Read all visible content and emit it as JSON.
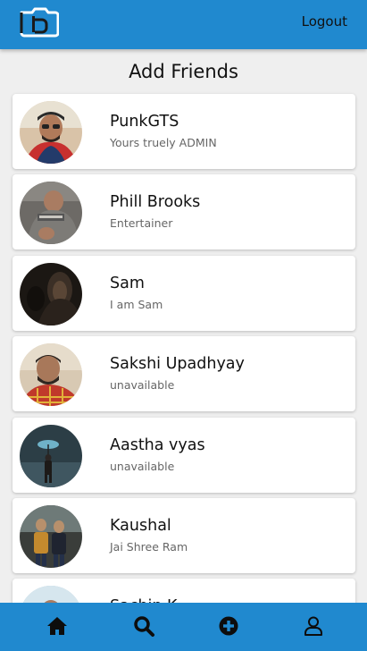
{
  "header": {
    "logout_label": "Logout",
    "brand_color": "#2089cf",
    "logo_icon": "camera-logo-icon"
  },
  "page": {
    "title": "Add Friends"
  },
  "friends": [
    {
      "name": "PunkGTS",
      "status": "Yours truely ADMIN"
    },
    {
      "name": "Phill Brooks",
      "status": "Entertainer"
    },
    {
      "name": "Sam",
      "status": "I am Sam"
    },
    {
      "name": "Sakshi Upadhyay",
      "status": "unavailable"
    },
    {
      "name": "Aastha vyas",
      "status": "unavailable"
    },
    {
      "name": "Kaushal",
      "status": "Jai Shree Ram"
    },
    {
      "name": "Sachin K",
      "status": ""
    }
  ],
  "nav": {
    "items": [
      {
        "icon": "home-icon"
      },
      {
        "icon": "search-icon"
      },
      {
        "icon": "add-circle-icon"
      },
      {
        "icon": "profile-icon"
      }
    ]
  }
}
